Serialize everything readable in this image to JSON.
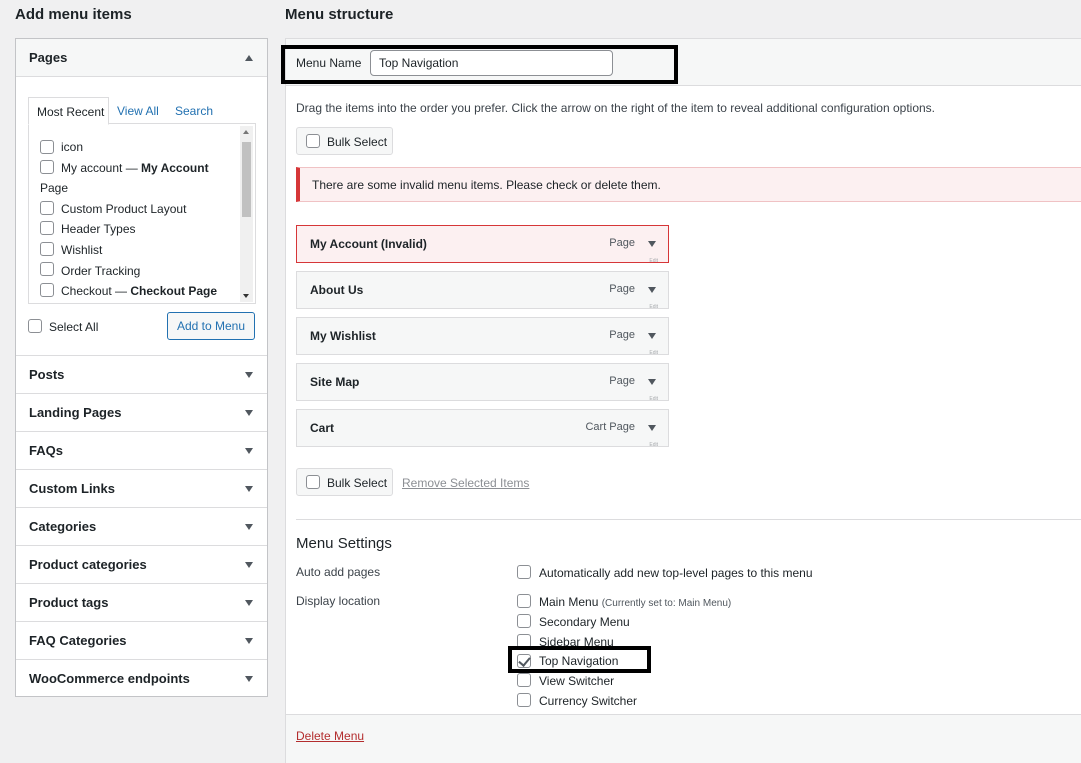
{
  "left_panel": {
    "title": "Add menu items",
    "pages": {
      "heading": "Pages",
      "tabs": [
        "Most Recent",
        "View All",
        "Search"
      ],
      "items": [
        {
          "label": "icon",
          "suffix": ""
        },
        {
          "label": "My account — ",
          "suffix": "My Account"
        },
        {
          "label": "Page",
          "suffix": ""
        },
        {
          "label": "Custom Product Layout",
          "suffix": ""
        },
        {
          "label": "Header Types",
          "suffix": ""
        },
        {
          "label": "Wishlist",
          "suffix": ""
        },
        {
          "label": "Order Tracking",
          "suffix": ""
        },
        {
          "label": "Checkout — ",
          "suffix": "Checkout Page"
        }
      ],
      "select_all": "Select All",
      "add_button": "Add to Menu"
    },
    "sections": [
      "Posts",
      "Landing Pages",
      "FAQs",
      "Custom Links",
      "Categories",
      "Product categories",
      "Product tags",
      "FAQ Categories",
      "WooCommerce endpoints"
    ]
  },
  "right_panel": {
    "title": "Menu structure",
    "menu_name_label": "Menu Name",
    "menu_name_value": "Top Navigation",
    "instructions": "Drag the items into the order you prefer. Click the arrow on the right of the item to reveal additional configuration options.",
    "bulk_select": "Bulk Select",
    "notice": "There are some invalid menu items. Please check or delete them.",
    "menu_items": [
      {
        "title": "My Account (Invalid)",
        "type": "Page",
        "invalid": true
      },
      {
        "title": "About Us",
        "type": "Page",
        "invalid": false
      },
      {
        "title": "My Wishlist",
        "type": "Page",
        "invalid": false
      },
      {
        "title": "Site Map",
        "type": "Page",
        "invalid": false
      },
      {
        "title": "Cart",
        "type": "Cart Page",
        "invalid": false
      }
    ],
    "edit_text": "Edit",
    "remove_selected": "Remove Selected Items",
    "settings": {
      "title": "Menu Settings",
      "auto_add_label": "Auto add pages",
      "auto_add_text": "Automatically add new top-level pages to this menu",
      "display_location_label": "Display location",
      "locations": [
        {
          "label": "Main Menu",
          "note": "(Currently set to: Main Menu)",
          "checked": false
        },
        {
          "label": "Secondary Menu",
          "note": "",
          "checked": false
        },
        {
          "label": "Sidebar Menu",
          "note": "",
          "checked": false
        },
        {
          "label": "Top Navigation",
          "note": "",
          "checked": true
        },
        {
          "label": "View Switcher",
          "note": "",
          "checked": false
        },
        {
          "label": "Currency Switcher",
          "note": "",
          "checked": false
        }
      ]
    },
    "delete_menu": "Delete Menu"
  }
}
